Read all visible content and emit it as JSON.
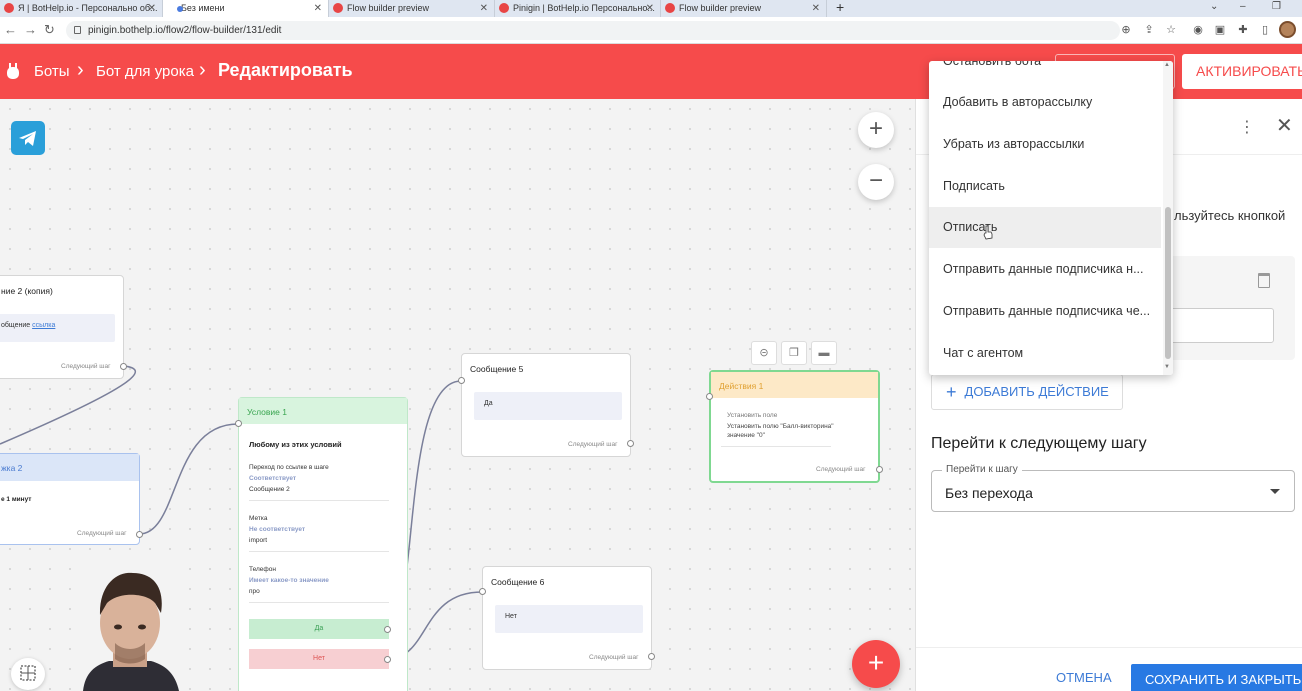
{
  "browser": {
    "tabs": [
      {
        "title": "Я | BotHelp.io - Персонально об..."
      },
      {
        "title": "Без имени"
      },
      {
        "title": "Flow builder preview"
      },
      {
        "title": "Pinigin | BotHelp.io Персонально..."
      },
      {
        "title": "Flow builder preview"
      }
    ],
    "url": "pinigin.bothelp.io/flow2/flow-builder/131/edit"
  },
  "header": {
    "crumb1": "Боты",
    "crumb2": "Бот для урока",
    "current": "Редактировать",
    "activate_button": "АКТИВИРОВАТЬ"
  },
  "canvas": {
    "node_msg2_copy": {
      "title": "ние 2 (копия)",
      "box_text": "общение",
      "box_link": "ссылка",
      "next": "Следующий шаг"
    },
    "node_delay2": {
      "title": "жка 2",
      "body": "е 1 минут",
      "next": "Следующий шаг"
    },
    "node_cond1": {
      "title": "Условие 1",
      "heading": "Любому из этих условий",
      "c1_label": "Переход по ссылке в шаге",
      "c1_op": "Соответствует",
      "c1_val": "Сообщение 2",
      "c2_label": "Метка",
      "c2_op": "Не соответствует",
      "c2_val": "import",
      "c3_label": "Телефон",
      "c3_op": "Имеет какое-то значение",
      "c3_val": "про",
      "yes": "Да",
      "no": "Нет"
    },
    "node_msg5": {
      "title": "Сообщение 5",
      "box_text": "Да",
      "next": "Следующий шаг"
    },
    "node_msg6": {
      "title": "Сообщение 6",
      "box_text": "Нет",
      "next": "Следующий шаг"
    },
    "node_act1": {
      "title": "Действия 1",
      "label": "Установить поле",
      "desc": "Установить полю \"Балл-викторина\"",
      "desc2": "значение \"0\"",
      "next": "Следующий шаг"
    }
  },
  "panel": {
    "hint_tail": "льзуйтесь кнопкой",
    "add_action": "ДОБАВИТЬ ДЕЙСТВИЕ",
    "next_step_title": "Перейти к следующему шагу",
    "select_label": "Перейти к шагу",
    "select_value": "Без перехода",
    "cancel": "ОТМЕНА",
    "save": "СОХРАНИТЬ И ЗАКРЫТЬ"
  },
  "dropdown": {
    "items": [
      "Остановить бота",
      "Добавить в авторассылку",
      "Убрать из авторассылки",
      "Подписать",
      "Отписать",
      "Отправить данные подписчика н...",
      "Отправить данные подписчика че...",
      "Чат с агентом"
    ],
    "hovered_index": 4
  },
  "colors": {
    "brand": "#f64b4b",
    "accent": "#2879e3"
  }
}
